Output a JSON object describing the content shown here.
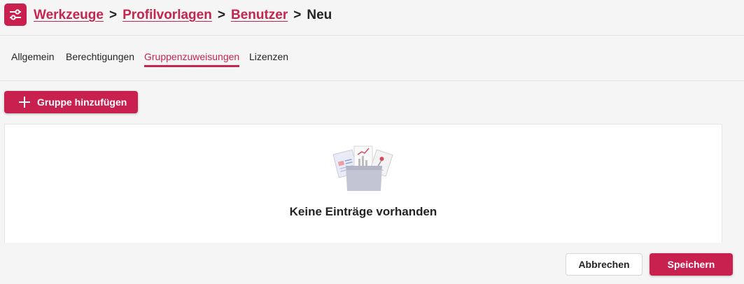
{
  "header": {
    "icon": "sliders-icon",
    "breadcrumb": {
      "items": [
        "Werkzeuge",
        "Profilvorlagen",
        "Benutzer"
      ],
      "separator": ">",
      "current": "Neu"
    }
  },
  "tabs": [
    {
      "label": "Allgemein",
      "active": false
    },
    {
      "label": "Berechtigungen",
      "active": false
    },
    {
      "label": "Gruppenzuweisungen",
      "active": true
    },
    {
      "label": "Lizenzen",
      "active": false
    }
  ],
  "toolbar": {
    "add_group_label": "Gruppe hinzufügen",
    "add_icon": "plus-icon"
  },
  "empty_state": {
    "icon": "empty-documents-box-icon",
    "message": "Keine Einträge vorhanden"
  },
  "footer": {
    "cancel_label": "Abbrechen",
    "save_label": "Speichern"
  },
  "colors": {
    "accent": "#c8204f",
    "background": "#f5f5f5",
    "panel": "#ffffff"
  }
}
